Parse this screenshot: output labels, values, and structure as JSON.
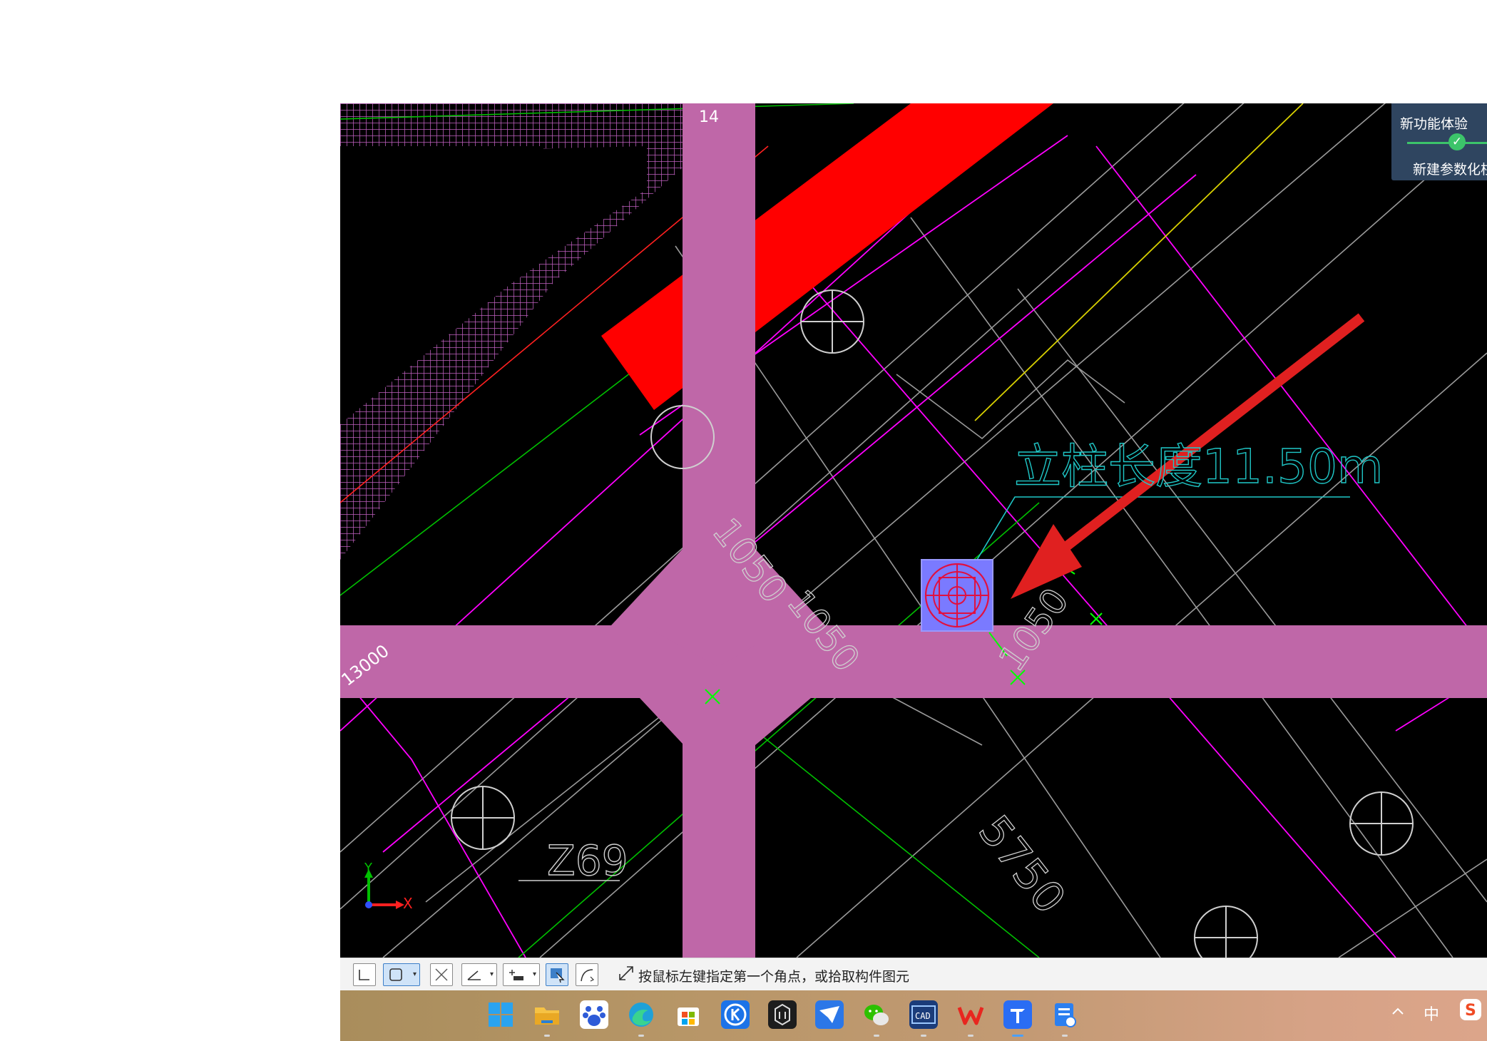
{
  "cad": {
    "axis_label_top": "14",
    "dim_13000": "13000",
    "dim_1050_a": "1050",
    "dim_1050_b": "1050",
    "dim_1050_c": "1050",
    "dim_5750": "5750",
    "column_tag": "Z69",
    "annotation_cyan": "立柱长度11.50m",
    "ucs_y": "Y",
    "ucs_x": "X"
  },
  "panel": {
    "title": "新功能体验",
    "subtitle": "新建参数化柱"
  },
  "statusbar": {
    "message": "按鼠标左键指定第一个角点，或拾取构件图元",
    "buttons": [
      "orthogonal",
      "snap-box",
      "cross",
      "angle",
      "offset",
      "select-mode",
      "arc"
    ]
  },
  "taskbar": {
    "apps": [
      "start",
      "file-explorer",
      "baidu-netdisk",
      "edge",
      "microsoft-store",
      "kugou",
      "unknown-dark-app",
      "feishu",
      "wechat",
      "cad-viewer",
      "wps",
      "tencent-docs",
      "note-app"
    ],
    "tray_ime": "中",
    "tray_sogou": "S"
  },
  "colors": {
    "canvas_bg": "#000000",
    "beam": "#bf67a8",
    "red_beam": "#ff0000",
    "hatch": "#c060c0",
    "magenta_line": "#ff00ff",
    "green_line": "#00c000",
    "cyan_text": "#1fc7c7",
    "yellow_line": "#d8d000",
    "selection": "#7a7aff",
    "arrow": "#e02020",
    "panel_bg": "#2f4560",
    "accent_green": "#3cc46a"
  }
}
